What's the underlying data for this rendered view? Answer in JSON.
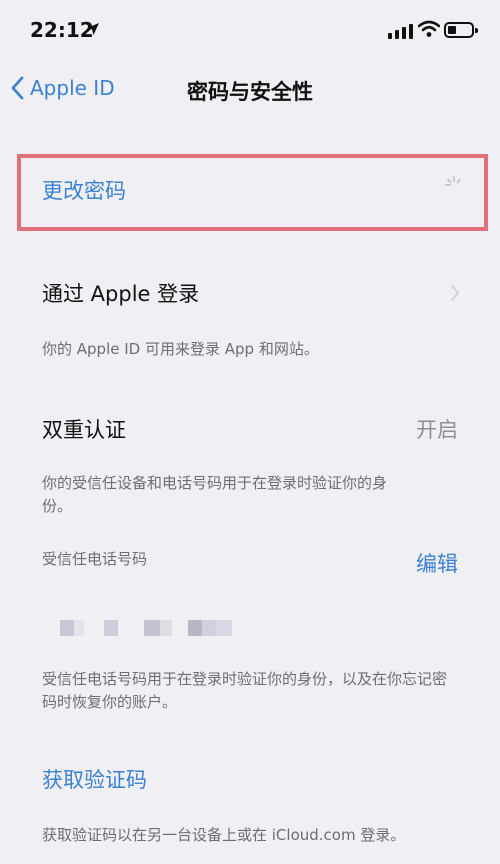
{
  "status": {
    "time": "22:12"
  },
  "nav": {
    "back_label": "Apple ID",
    "title": "密码与安全性"
  },
  "rows": {
    "change_password": "更改密码",
    "sign_in_with_apple": "通过 Apple 登录",
    "sign_in_footnote": "你的 Apple ID 可用来登录 App 和网站。",
    "two_factor": "双重认证",
    "two_factor_value": "开启",
    "two_factor_footnote": "你的受信任设备和电话号码用于在登录时验证你的身份。",
    "trusted_phone_header": "受信任电话号码",
    "edit": "编辑",
    "trusted_phone_footnote": "受信任电话号码用于在登录时验证你的身份，以及在你忘记密码时恢复你的账户。",
    "get_code": "获取验证码",
    "get_code_footnote": "获取验证码以在另一台设备上或在 iCloud.com 登录。"
  },
  "colors": {
    "accent": "#3b82d0",
    "highlight": "#e0707a",
    "background": "#efeff4"
  },
  "icons": [
    "location-arrow-icon",
    "cellular-signal-icon",
    "wifi-icon",
    "battery-icon",
    "chevron-left-icon",
    "spinner-icon",
    "chevron-right-icon"
  ]
}
